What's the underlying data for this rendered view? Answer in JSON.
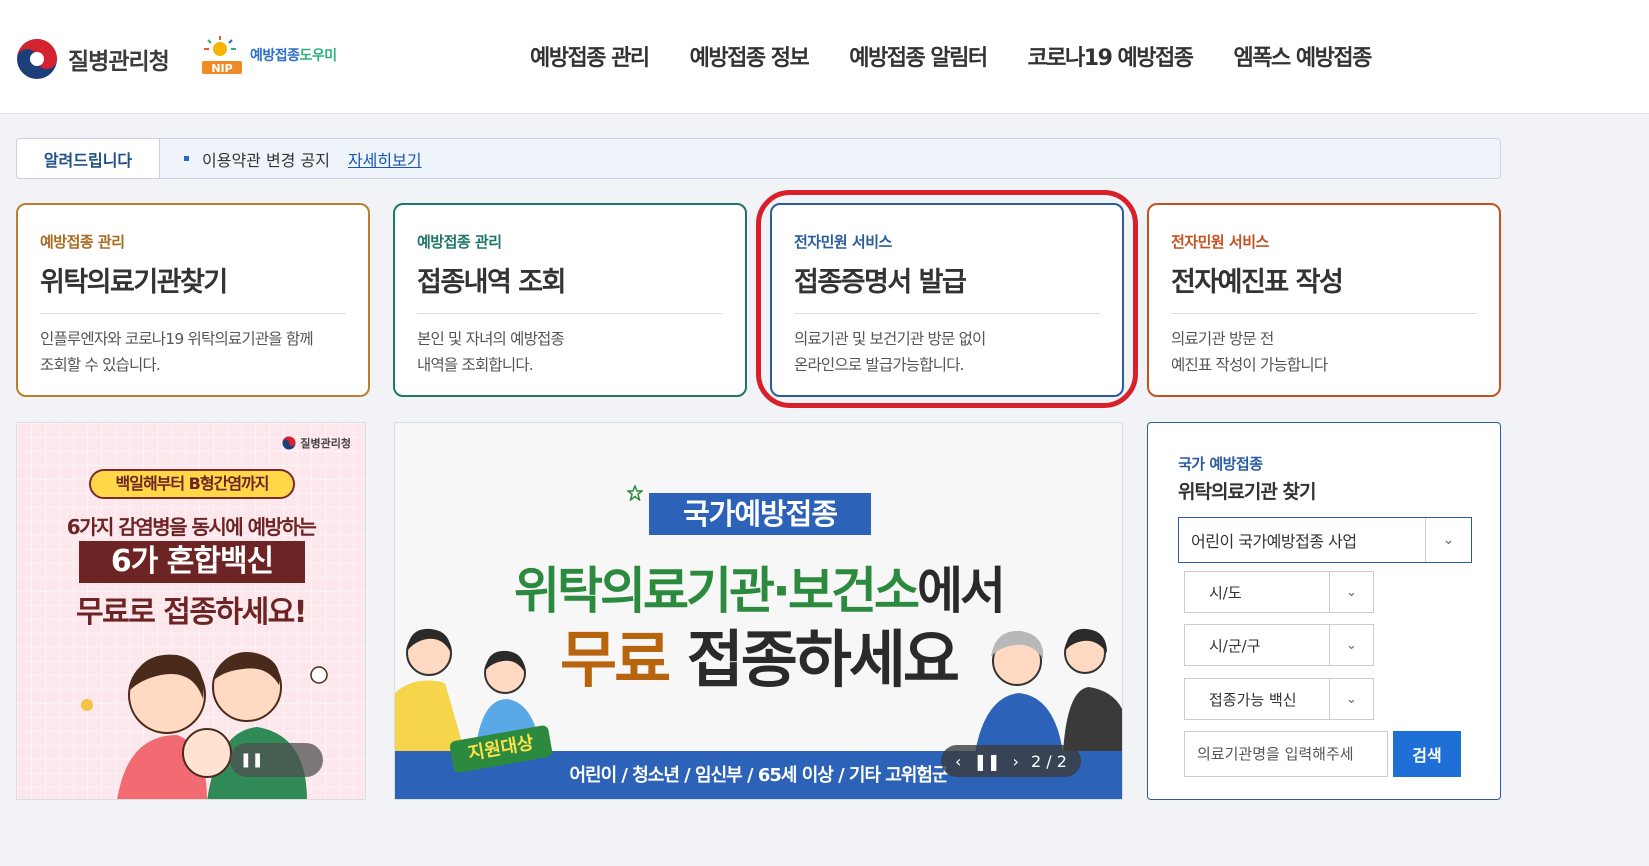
{
  "header": {
    "kdca_name": "질병관리청",
    "nip_letters": "NIP",
    "nip_name_a": "예방접종",
    "nip_name_b": "도우미",
    "nav": [
      "예방접종 관리",
      "예방접종 정보",
      "예방접종 알림터",
      "코로나19 예방접종",
      "엠폭스 예방접종"
    ]
  },
  "notice": {
    "label": "알려드립니다",
    "text": "이용약관 변경 공지",
    "link": "자세히보기"
  },
  "cards": [
    {
      "category": "예방접종 관리",
      "title": "위탁의료기관찾기",
      "desc1": "인플루엔자와 코로나19 위탁의료기관을 함께",
      "desc2": "조회할 수 있습니다."
    },
    {
      "category": "예방접종 관리",
      "title": "접종내역 조회",
      "desc1": "본인 및 자녀의 예방접종",
      "desc2": "내역을 조회합니다."
    },
    {
      "category": "전자민원 서비스",
      "title": "접종증명서 발급",
      "desc1": "의료기관 및 보건기관 방문 없이",
      "desc2": "온라인으로 발급가능합니다."
    },
    {
      "category": "전자민원 서비스",
      "title": "전자예진표 작성",
      "desc1": "의료기관 방문 전",
      "desc2": "예진표 작성이 가능합니다"
    }
  ],
  "banner_left": {
    "org": "질병관리청",
    "pill": "백일해부터 B형간염까지",
    "line1": "6가지 감염병을 동시에 예방하는",
    "line2": "6가 혼합백신",
    "line3": "무료로 접종하세요!"
  },
  "banner_center": {
    "tag": "국가예방접종",
    "line1_green": "위탁의료기관·보건소",
    "line1_rest": "에서",
    "line2_orange": "무료",
    "line2_rest": " 접종하세요",
    "badge": "지원대상",
    "bottom": "어린이 / 청소년 / 임신부 / 65세 이상 / 기타 고위험군",
    "counter": "2 / 2"
  },
  "search_panel": {
    "category": "국가 예방접종",
    "title": "위탁의료기관 찾기",
    "program": "어린이 국가예방접종 사업",
    "sido": "시/도",
    "sigungu": "시/군/구",
    "vaccine": "접종가능 백신",
    "placeholder": "의료기관명을 입력해주세",
    "button": "검색"
  },
  "colors": {
    "brand_blue": "#2b5c9e",
    "highlight_red": "#d81f2a",
    "search_button": "#1e6fd6"
  }
}
